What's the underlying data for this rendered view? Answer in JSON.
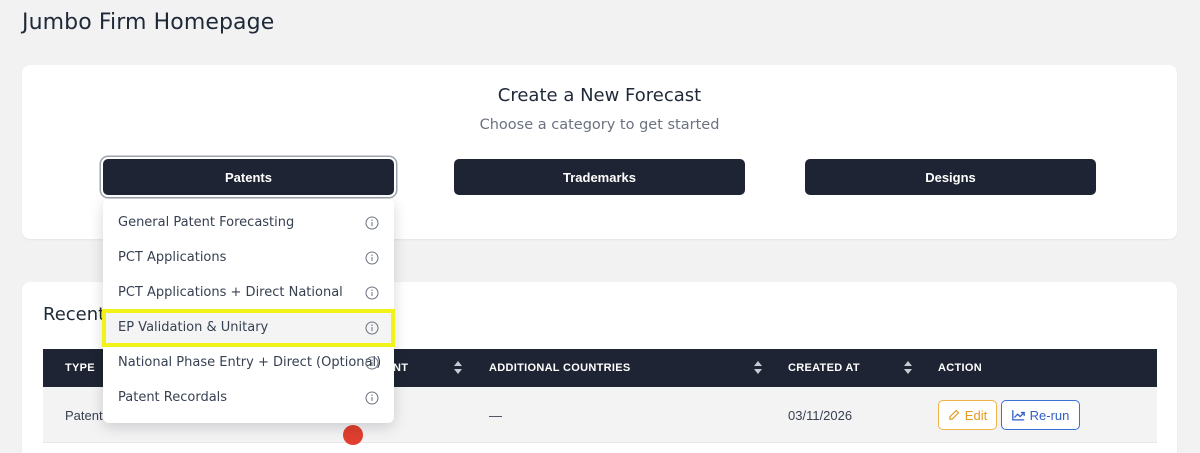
{
  "page": {
    "title": "Jumbo Firm Homepage"
  },
  "forecast": {
    "title": "Create a New Forecast",
    "subtitle": "Choose a category to get started",
    "categories": [
      {
        "label": "Patents",
        "active": true
      },
      {
        "label": "Trademarks",
        "active": false
      },
      {
        "label": "Designs",
        "active": false
      }
    ]
  },
  "dropdown": {
    "items": [
      {
        "label": "General Patent Forecasting",
        "icon": "info-icon"
      },
      {
        "label": "PCT Applications",
        "icon": "info-icon"
      },
      {
        "label": "PCT Applications + Direct National",
        "icon": "info-icon"
      },
      {
        "label": "EP Validation & Unitary",
        "icon": "info-icon",
        "highlighted": true
      },
      {
        "label": "National Phase Entry + Direct (Optional)",
        "icon": "info-icon"
      },
      {
        "label": "Patent Recordals",
        "icon": "info-icon"
      }
    ]
  },
  "recent": {
    "title": "Recent",
    "columns": [
      {
        "label": "TYPE"
      },
      {
        "label": "NT"
      },
      {
        "label": "ADDITIONAL COUNTRIES"
      },
      {
        "label": "CREATED AT"
      },
      {
        "label": "ACTION"
      }
    ],
    "rows": [
      {
        "type": "Patent",
        "additional_countries": "—",
        "created_at": "03/11/2026",
        "edit_label": "Edit",
        "rerun_label": "Re-run"
      }
    ]
  },
  "colors": {
    "dark": "#1e2433",
    "highlight": "#f1f21a",
    "edit": "#e59a20",
    "rerun": "#2f5fc4"
  }
}
